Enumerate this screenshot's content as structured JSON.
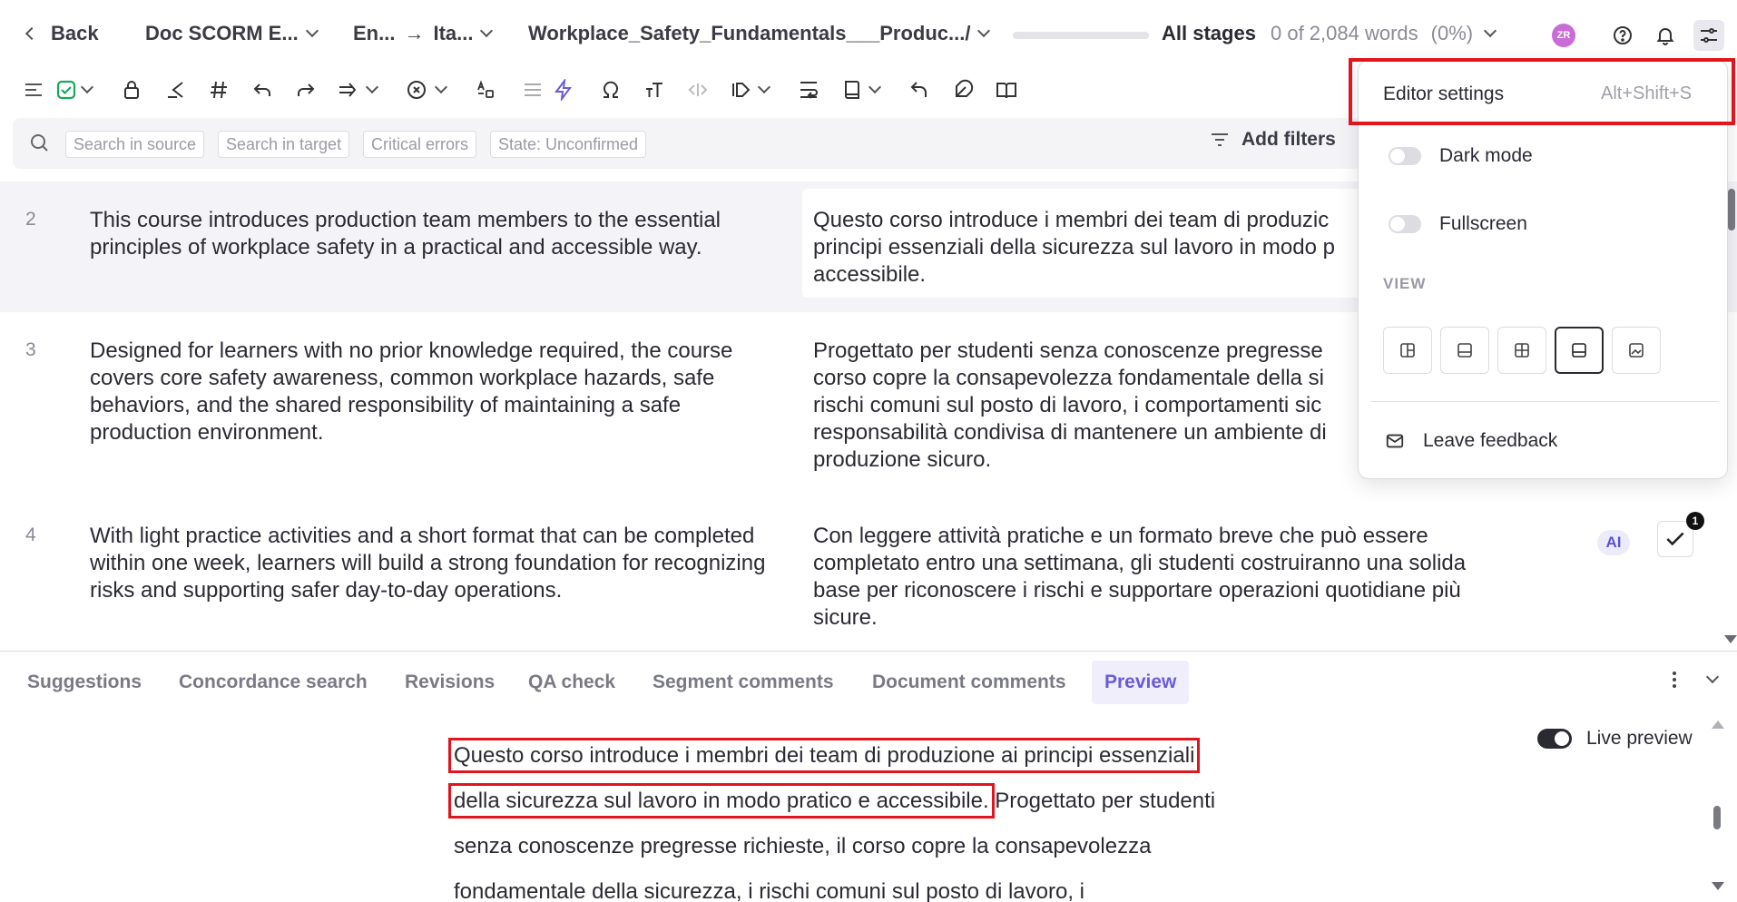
{
  "header": {
    "back_label": "Back",
    "doc_label": "Doc SCORM E...",
    "lang_source": "En...",
    "lang_target": "Ita...",
    "file_label": "Workplace_Safety_Fundamentals___Produc.../",
    "progress": 0,
    "stages_label": "All stages",
    "words_label": "0 of 2,084 words",
    "percent_label": "(0%)",
    "avatar_initials": "ZR"
  },
  "filters": {
    "chips": [
      "Search in source",
      "Search in target",
      "Critical errors",
      "State: Unconfirmed"
    ],
    "add_label": "Add filters"
  },
  "segments": [
    {
      "num": "2",
      "source": "This course introduces production team members to the essential principles of workplace safety in a practical and accessible way.",
      "target": "Questo corso introduce i membri dei team di produzic principi essenziali della sicurezza sul lavoro in modo p accessibile."
    },
    {
      "num": "3",
      "source": "Designed for learners with no prior knowledge required, the course covers core safety awareness, common workplace hazards, safe behaviors, and the shared responsibility of maintaining a safe production environment.",
      "target": "Progettato per studenti senza conoscenze pregresse corso copre la consapevolezza fondamentale della si rischi comuni sul posto di lavoro, i comportamenti sic responsabilità condivisa di mantenere un ambiente di produzione sicuro."
    },
    {
      "num": "4",
      "source": "With light practice activities and a short format that can be completed within one week, learners will build a strong foundation for recognizing risks and supporting safer day-to-day operations.",
      "target": "Con leggere attività pratiche e un formato breve che può essere completato entro una settimana, gli studenti costruiranno una solida base per riconoscere i rischi e supportare operazioni quotidiane più sicure.",
      "ai_badge": "AI",
      "comment_count": "1"
    }
  ],
  "panel": {
    "tabs": [
      "Suggestions",
      "Concordance search",
      "Revisions",
      "QA check",
      "Segment comments",
      "Document comments",
      "Preview"
    ],
    "active_tab": "Preview",
    "live_preview_label": "Live preview",
    "preview": {
      "hl_line1": "Questo corso introduce i membri dei team di produzione ai principi essenziali",
      "hl_line2": "della sicurezza sul lavoro in modo pratico e accessibile.",
      "rest_line2": " Progettato per studenti",
      "line3": "senza conoscenze pregresse richieste, il corso copre la consapevolezza",
      "line4": "fondamentale della sicurezza, i rischi comuni sul posto di lavoro, i"
    }
  },
  "settings_menu": {
    "title": "Editor settings",
    "shortcut": "Alt+Shift+S",
    "dark_mode_label": "Dark mode",
    "fullscreen_label": "Fullscreen",
    "view_label": "VIEW",
    "feedback_label": "Leave feedback"
  },
  "colors": {
    "accent": "#6a5bd8",
    "highlight_red": "#e0161c",
    "confirm_green": "#1aa85a",
    "avatar": "#c96bd8"
  }
}
